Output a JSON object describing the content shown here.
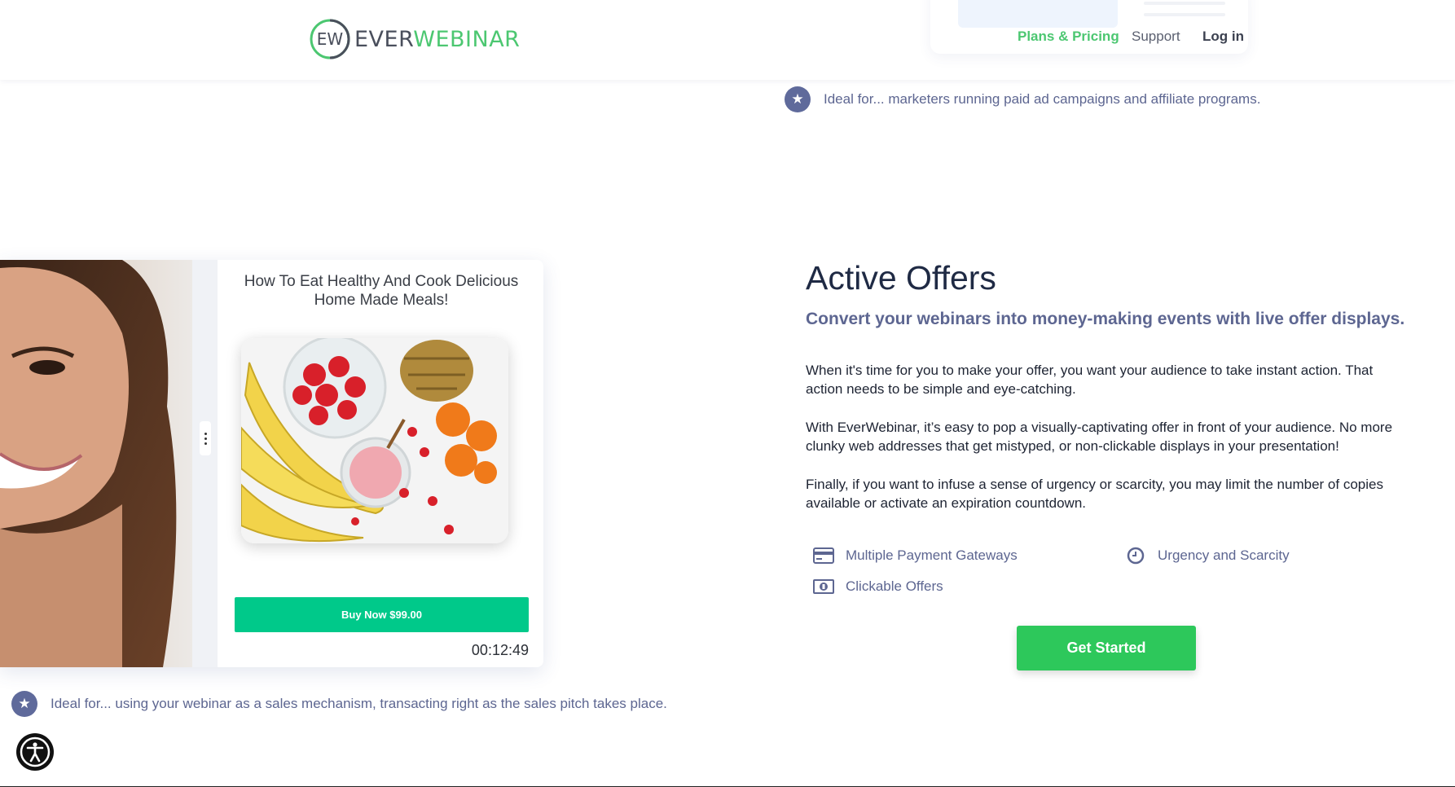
{
  "header": {
    "logo": {
      "mark_text": "EW",
      "ever": "EVER",
      "webinar": "WEBINAR"
    },
    "nav": {
      "plans": "Plans & Pricing",
      "support": "Support",
      "login": "Log in"
    }
  },
  "top_ideal": {
    "text": "Ideal for... marketers running paid ad campaigns and affiliate programs."
  },
  "mock": {
    "offer_title": "How To Eat Healthy And Cook Delicious Home Made Meals!",
    "buy_label": "Buy Now $99.00",
    "timer": "00:12:49"
  },
  "section": {
    "title": "Active Offers",
    "subtitle": "Convert your webinars into money-making events with live offer displays.",
    "paragraphs": [
      "When it's time for you to make your offer, you want your audience to take instant action. That action needs to be simple and eye-catching.",
      "With EverWebinar, it’s easy to pop a visually-captivating offer in front of your audience.  No more clunky web addresses that get mistyped, or non-clickable displays in your presentation!",
      "Finally, if you want to infuse a sense of urgency or scarcity, you may limit the number of copies available or activate an expiration countdown."
    ],
    "features": [
      {
        "label": "Multiple Payment Gateways",
        "icon": "credit-card-icon"
      },
      {
        "label": "Urgency and Scarcity",
        "icon": "clock-icon"
      },
      {
        "label": "Clickable Offers",
        "icon": "money-bill-icon"
      }
    ],
    "cta": "Get Started"
  },
  "bottom_ideal": {
    "text": "Ideal for... using your webinar as a sales mechanism, transacting right as the sales pitch takes place."
  },
  "colors": {
    "brand_green": "#4cc771",
    "accent_purple": "#5d6691",
    "cta_green": "#2dc85b",
    "buy_green": "#00c98a"
  }
}
